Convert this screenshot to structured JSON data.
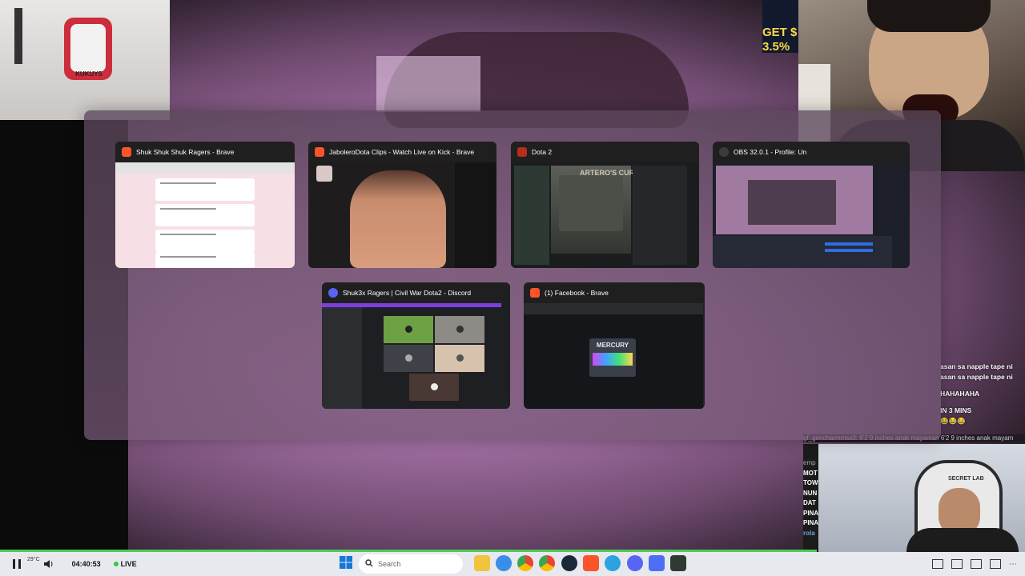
{
  "overlays": {
    "cam_logo_text": "KUKUYS",
    "ad_text": "GET $ 3.5%",
    "seat_brand": "SECRET LAB"
  },
  "chat": {
    "lines": [
      "asan sa napple tape ni",
      "asan sa napple tape ni",
      "HAHAHAHA",
      "IN 3 MINS",
      "😂😂😂"
    ],
    "ticker": "gf_gencharmmss0: 6'2 9 inches anak mayaman 6'2 9 inches anak mayam",
    "left_tags": [
      "emp",
      "MOT",
      "TOW",
      "NUN",
      "DAT",
      "PINA",
      "PINA",
      "rola"
    ]
  },
  "switcher": {
    "windows": [
      {
        "title": "Shuk Shuk Shuk Ragers - Brave",
        "icon": "brave-icon",
        "accent": "#fb542b"
      },
      {
        "title": "JaboleroDota Clips - Watch Live on Kick - Brave",
        "icon": "brave-icon",
        "accent": "#fb542b"
      },
      {
        "title": "Dota 2",
        "icon": "dota-icon",
        "accent": "#b62d1e"
      },
      {
        "title": "OBS 32.0.1 - Profile: Un",
        "icon": "obs-icon",
        "accent": "#3c3c3c"
      },
      {
        "title": "Shuk3x Ragers | Civil War Dota2 - Discord",
        "icon": "discord-icon",
        "accent": "#5865f2"
      },
      {
        "title": "(1) Facebook - Brave",
        "icon": "brave-icon",
        "accent": "#fb542b"
      }
    ],
    "thumb_text": {
      "dota_art": "ARTERO'S CURIOS",
      "fb_card": "MERCURY"
    }
  },
  "taskbar": {
    "weather": "29°C",
    "time": "04:40:53",
    "live_label": "LIVE",
    "search_placeholder": "Search",
    "apps": [
      "file-explorer-icon",
      "browser-icon",
      "chrome-icon",
      "chrome-icon",
      "steam-icon",
      "brave-icon",
      "telegram-icon",
      "discord-icon",
      "notes-icon",
      "terminal-icon"
    ]
  }
}
